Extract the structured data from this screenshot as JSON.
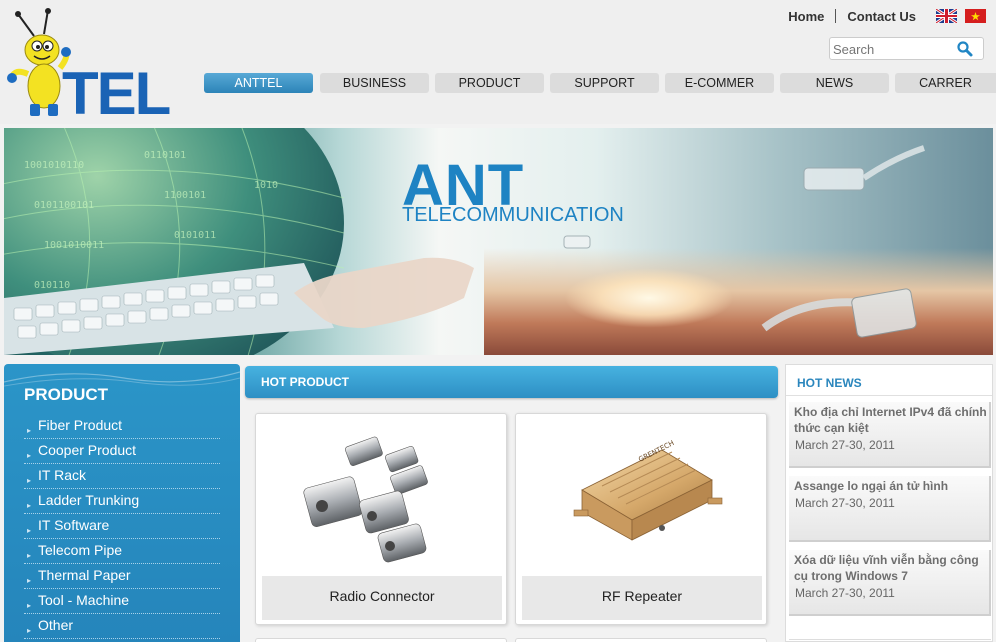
{
  "header": {
    "logo_text": "TEL",
    "home_link": "Home",
    "contact_link": "Contact Us",
    "search_placeholder": "Search"
  },
  "nav": {
    "items": [
      "ANTTEL",
      "BUSINESS",
      "PRODUCT",
      "SUPPORT",
      "E-COMMER",
      "NEWS",
      "CARRER"
    ],
    "active": "ANTTEL"
  },
  "banner": {
    "title": "ANT",
    "subtitle": "TELECOMMUNICATION"
  },
  "sidebar": {
    "title": "PRODUCT",
    "items": [
      "Fiber Product",
      "Cooper Product",
      "IT Rack",
      "Ladder Trunking",
      "IT Software",
      "Telecom Pipe",
      "Thermal Paper",
      "Tool - Machine",
      "Other"
    ]
  },
  "hot_product": {
    "title": "HOT PRODUCT",
    "products": [
      {
        "name": "Radio Connector"
      },
      {
        "name": "RF Repeater"
      }
    ]
  },
  "hot_news": {
    "title": "HOT NEWS",
    "items": [
      {
        "title": "Kho địa chỉ Internet IPv4 đã chính thức cạn kiệt",
        "date": "March 27-30, 2011"
      },
      {
        "title": "Assange lo ngại án tử hình",
        "date": "March 27-30, 2011"
      },
      {
        "title": "Xóa dữ liệu vĩnh viễn bằng công cụ trong Windows 7",
        "date": "March 27-30, 2011"
      }
    ]
  },
  "colors": {
    "brand_blue": "#1a63b5",
    "accent_blue": "#2b95c8",
    "nav_active": "#3b93c6",
    "news_title": "#6e6e6e"
  }
}
